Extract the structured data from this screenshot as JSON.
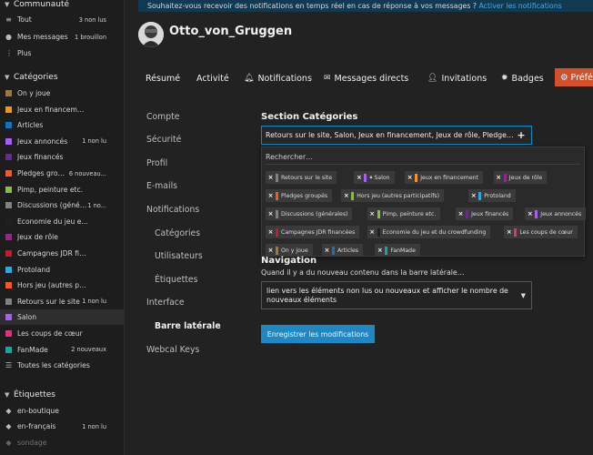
{
  "notice": {
    "text": "Souhaitez-vous recevoir des notifications en temps réel en cas de réponse à vos messages ?",
    "link": "Activer les notifications"
  },
  "user": {
    "username": "Otto_von_Gruggen"
  },
  "sidebar": {
    "community": {
      "title": "Communauté",
      "items": [
        {
          "label": "Tout",
          "badge": "3 non lus",
          "icon": "layers-icon"
        },
        {
          "label": "Mes messages",
          "badge": "1 brouillon",
          "icon": "user-icon"
        },
        {
          "label": "Plus",
          "badge": "",
          "icon": "more-icon"
        }
      ]
    },
    "categories": {
      "title": "Catégories",
      "items": [
        {
          "label": "On y joue",
          "badge": "",
          "color": "#9c7a3c"
        },
        {
          "label": "Jeux en financement",
          "badge": "",
          "color": "#f7941d"
        },
        {
          "label": "Articles",
          "badge": "",
          "color": "#0e76bd"
        },
        {
          "label": "Jeux annoncés",
          "badge": "1 non lu",
          "color": "#a461ef"
        },
        {
          "label": "Jeux financés",
          "badge": "",
          "color": "#652d90"
        },
        {
          "label": "Pledges group...",
          "badge": "6 nouveau...",
          "color": "#f1592a"
        },
        {
          "label": "Pimp, peinture etc.",
          "badge": "",
          "color": "#8ebb45"
        },
        {
          "label": "Discussions (généra...",
          "badge": "1 no...",
          "color": "#808281"
        },
        {
          "label": "Economie du jeu et du cro...",
          "badge": "",
          "color": "#231f20"
        },
        {
          "label": "Jeux de rôle",
          "badge": "",
          "color": "#92278f"
        },
        {
          "label": "Campagnes JDR financées",
          "badge": "",
          "color": "#bf1e2e"
        },
        {
          "label": "Protoland",
          "badge": "",
          "color": "#25aae1"
        },
        {
          "label": "Hors jeu (autres participa...",
          "badge": "",
          "color": "#f1592a"
        },
        {
          "label": "Retours sur le site",
          "badge": "1 non lu",
          "color": "#808281"
        },
        {
          "label": "Salon",
          "badge": "",
          "color": "#a461ef"
        },
        {
          "label": "Les coups de cœur",
          "badge": "",
          "color": "#e1307c"
        },
        {
          "label": "FanMade",
          "badge": "2 nouveaux",
          "color": "#12a89d"
        },
        {
          "label": "Toutes les catégories",
          "badge": "",
          "icon": "list-icon"
        }
      ]
    },
    "tags": {
      "title": "Étiquettes",
      "items": [
        {
          "label": "en-boutique",
          "badge": "",
          "icon": "tag-icon"
        },
        {
          "label": "en-français",
          "badge": "1 non lu",
          "icon": "tag-icon"
        },
        {
          "label": "sondage",
          "badge": "",
          "icon": "tag-icon"
        }
      ]
    }
  },
  "nav": {
    "tabs": [
      {
        "label": "Résumé",
        "icon": ""
      },
      {
        "label": "Activité",
        "icon": ""
      },
      {
        "label": "Notifications",
        "icon": "bell-icon"
      },
      {
        "label": "Messages directs",
        "icon": "envelope-icon"
      },
      {
        "label": "Invitations",
        "icon": "user-plus-icon"
      },
      {
        "label": "Badges",
        "icon": "certificate-icon"
      }
    ],
    "prefs_label": "Préférences"
  },
  "prefs_menu": {
    "items": [
      "Compte",
      "Sécurité",
      "Profil",
      "E-mails",
      "Notifications"
    ],
    "sub_items": [
      "Catégories",
      "Utilisateurs",
      "Étiquettes"
    ],
    "after_items": [
      "Interface"
    ],
    "current": "Barre latérale",
    "last": "Webcal Keys"
  },
  "section": {
    "title": "Section Catégories",
    "selected_value": "Retours sur le site, Salon, Jeux en financement, Jeux de rôle, Pledges groupés, Hors jeu (autres participatifs), Protoland, Discussions (générales), Pimp, peinture etc., Jeux financés, Jeux annoncés, Campagnes JDR financées, Economie du jeu et du crowdfunding, Les coups de cœur, On y joue, Articles, FanMade",
    "search_placeholder": "Rechercher…",
    "chips": [
      {
        "label": "Retours sur le site",
        "color": "#808281"
      },
      {
        "label": "Salon",
        "color": "#a461ef",
        "locked": true
      },
      {
        "label": "Jeux en financement",
        "color": "#f7941d"
      },
      {
        "label": "Jeux de rôle",
        "color": "#92278f"
      },
      {
        "label": "Pledges groupés",
        "color": "#f1592a"
      },
      {
        "label": "Hors jeu (autres participatifs)",
        "color": "#8ebb45"
      },
      {
        "label": "Protoland",
        "color": "#25aae1"
      },
      {
        "label": "Discussions (générales)",
        "color": "#808281"
      },
      {
        "label": "Pimp, peinture etc.",
        "color": "#8ebb45"
      },
      {
        "label": "Jeux financés",
        "color": "#652d90"
      },
      {
        "label": "Jeux annoncés",
        "color": "#a461ef"
      },
      {
        "label": "Campagnes JDR financées",
        "color": "#bf1e2e"
      },
      {
        "label": "Economie du jeu et du crowdfunding",
        "color": "#231f20"
      },
      {
        "label": "Les coups de cœur",
        "color": "#e1307c"
      },
      {
        "label": "On y joue",
        "color": "#9c7a3c"
      },
      {
        "label": "Articles",
        "color": "#0e76bd"
      },
      {
        "label": "FanMade",
        "color": "#12a89d"
      }
    ]
  },
  "navigation": {
    "title": "Navigation",
    "description": "Quand il y a du nouveau contenu dans la barre latérale…",
    "selected": "lien vers les éléments non lus ou nouveaux et afficher le nombre de nouveaux éléments"
  },
  "save_label": "Enregistrer les modifications",
  "colors": {
    "accent": "#1f87c4",
    "prefs_tab": "#d2502c",
    "notice_bg": "#103a52"
  }
}
